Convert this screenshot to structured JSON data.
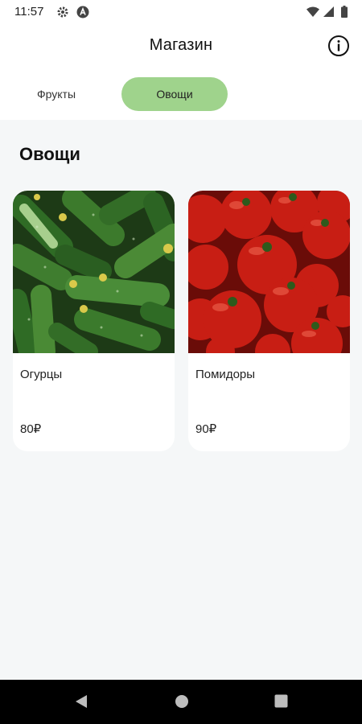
{
  "status_bar": {
    "time": "11:57",
    "icons": [
      "settings-icon",
      "app-notification-icon",
      "wifi-icon",
      "signal-icon",
      "battery-icon"
    ]
  },
  "app_bar": {
    "title": "Магазин",
    "info_icon": "info-icon"
  },
  "tabs": [
    {
      "label": "Фрукты",
      "selected": false
    },
    {
      "label": "Овощи",
      "selected": true
    }
  ],
  "section": {
    "title": "Овощи"
  },
  "products": [
    {
      "name": "Огурцы",
      "price": "80₽",
      "image": "cucumbers-photo"
    },
    {
      "name": "Помидоры",
      "price": "90₽",
      "image": "tomatoes-photo"
    }
  ],
  "nav_bar": {
    "icons": [
      "back-icon",
      "home-icon",
      "recents-icon"
    ]
  },
  "colors": {
    "selected_tab": "#9fd38c",
    "content_background": "#f5f7f8",
    "nav_bar": "#000000"
  }
}
